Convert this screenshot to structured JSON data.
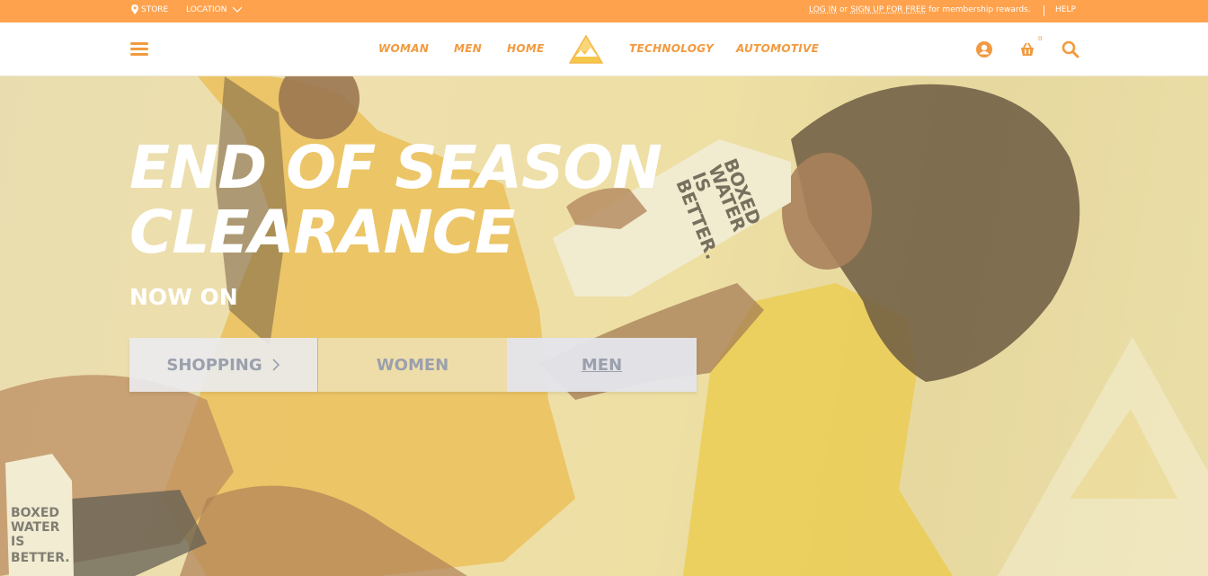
{
  "topbar": {
    "store_label": "STORE",
    "location_label": "LOCATION",
    "login_label": "LOG IN",
    "or_text": "or",
    "signup_label": "SIGN UP FOR FREE",
    "rewards_text": "for membership rewards.",
    "help_label": "HELP"
  },
  "nav": {
    "links": [
      "WOMAN",
      "MEN",
      "HOME",
      "TECHNOLOGY",
      "AUTOMOTIVE"
    ],
    "cart_count": "0"
  },
  "hero": {
    "title_line1": "END OF SEASON",
    "title_line2": "CLEARANCE",
    "subtitle": "NOW ON",
    "cta": {
      "shopping": "SHOPPING",
      "women": "WOMEN",
      "men": "MEN"
    },
    "carton_text": [
      "BOXED",
      "WATER",
      "IS",
      "BETTER."
    ]
  },
  "colors": {
    "accent": "#ffa24d",
    "nav_text": "#f29a3f",
    "cta_text": "#9aa0ad"
  }
}
